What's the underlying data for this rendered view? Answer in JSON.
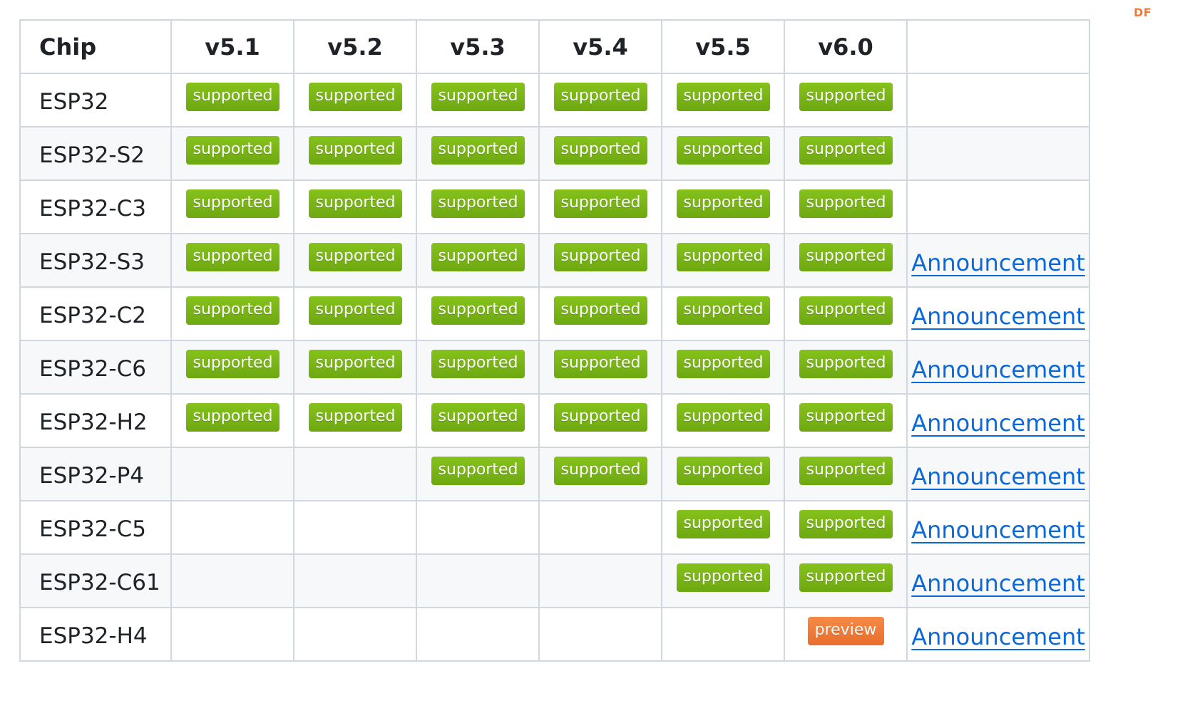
{
  "watermark": "DF",
  "table": {
    "headers": [
      "Chip",
      "v5.1",
      "v5.2",
      "v5.3",
      "v5.4",
      "v5.5",
      "v6.0",
      ""
    ],
    "rows": [
      {
        "chip": "ESP32",
        "cells": [
          "supported",
          "supported",
          "supported",
          "supported",
          "supported",
          "supported"
        ],
        "link": ""
      },
      {
        "chip": "ESP32-S2",
        "cells": [
          "supported",
          "supported",
          "supported",
          "supported",
          "supported",
          "supported"
        ],
        "link": ""
      },
      {
        "chip": "ESP32-C3",
        "cells": [
          "supported",
          "supported",
          "supported",
          "supported",
          "supported",
          "supported"
        ],
        "link": ""
      },
      {
        "chip": "ESP32-S3",
        "cells": [
          "supported",
          "supported",
          "supported",
          "supported",
          "supported",
          "supported"
        ],
        "link": "Announcement"
      },
      {
        "chip": "ESP32-C2",
        "cells": [
          "supported",
          "supported",
          "supported",
          "supported",
          "supported",
          "supported"
        ],
        "link": "Announcement"
      },
      {
        "chip": "ESP32-C6",
        "cells": [
          "supported",
          "supported",
          "supported",
          "supported",
          "supported",
          "supported"
        ],
        "link": "Announcement"
      },
      {
        "chip": "ESP32-H2",
        "cells": [
          "supported",
          "supported",
          "supported",
          "supported",
          "supported",
          "supported"
        ],
        "link": "Announcement"
      },
      {
        "chip": "ESP32-P4",
        "cells": [
          "",
          "",
          "supported",
          "supported",
          "supported",
          "supported"
        ],
        "link": "Announcement"
      },
      {
        "chip": "ESP32-C5",
        "cells": [
          "",
          "",
          "",
          "",
          "supported",
          "supported"
        ],
        "link": "Announcement"
      },
      {
        "chip": "ESP32-C61",
        "cells": [
          "",
          "",
          "",
          "",
          "supported",
          "supported"
        ],
        "link": "Announcement"
      },
      {
        "chip": "ESP32-H4",
        "cells": [
          "",
          "",
          "",
          "",
          "",
          "preview"
        ],
        "link": "Announcement"
      }
    ]
  },
  "colors": {
    "supported": "#78b516",
    "preview": "#ef7a3a",
    "link": "#0a69da",
    "border": "#d0d7de",
    "row_alt": "#f6f8fa"
  }
}
